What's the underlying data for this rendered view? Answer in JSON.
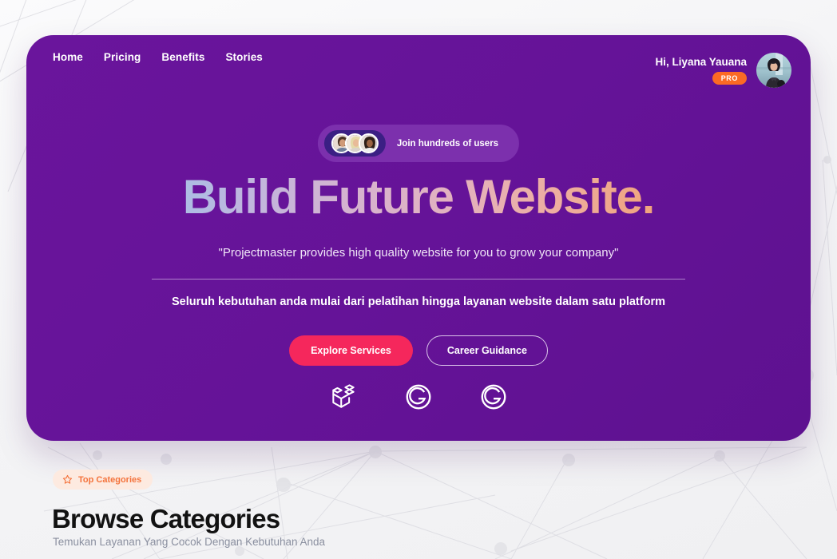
{
  "nav": {
    "items": [
      {
        "label": "Home"
      },
      {
        "label": "Pricing"
      },
      {
        "label": "Benefits"
      },
      {
        "label": "Stories"
      }
    ]
  },
  "user": {
    "greeting": "Hi, Liyana Yauana",
    "badge": "PRO",
    "avatar_icon": "user-photo-avatar"
  },
  "hero": {
    "join_pill": {
      "text": "Join hundreds of users",
      "avatar_count": 3
    },
    "headline": "Build Future Website.",
    "quote": "\"Projectmaster provides high quality website for you to grow your company\"",
    "subheadline": "Seluruh kebutuhan anda mulai dari pelatihan hingga layanan website dalam satu platform",
    "primary_button": "Explore Services",
    "secondary_button": "Career Guidance",
    "logos": [
      {
        "name": "laravel-logo"
      },
      {
        "name": "g-circle-logo"
      },
      {
        "name": "g-circle-logo"
      }
    ]
  },
  "categories_section": {
    "badge_label": "Top Categories",
    "badge_icon": "star-icon",
    "title": "Browse Categories",
    "subtitle": "Temukan Layanan Yang Cocok Dengan Kebutuhan Anda"
  },
  "colors": {
    "hero_purple": "#661398",
    "accent_pink": "#f5275c",
    "accent_orange": "#fb6a24",
    "badge_peach": "#fdeae0",
    "page_background": "#f4f4f6"
  }
}
